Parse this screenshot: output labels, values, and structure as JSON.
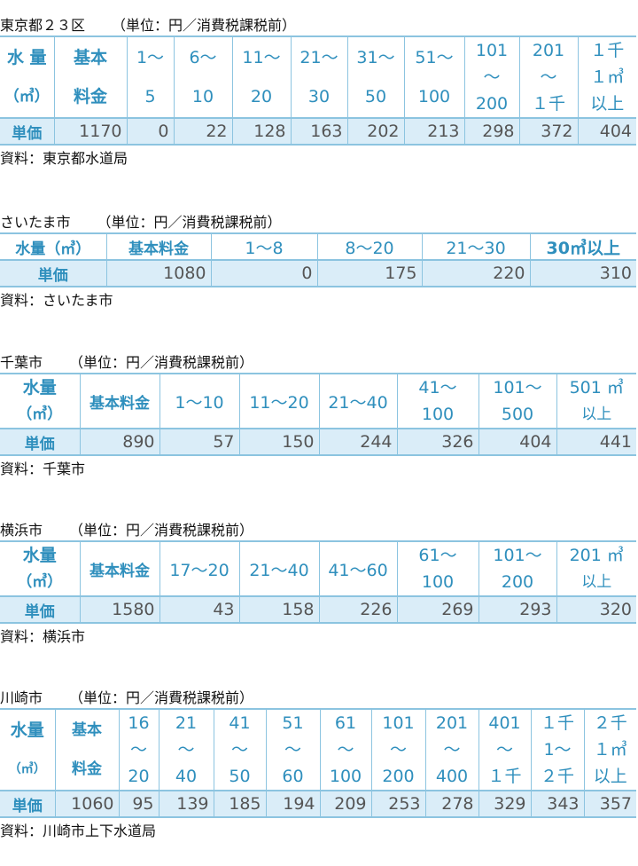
{
  "tokyo": {
    "title": "東京都２３区",
    "unit": "（単位：円／消費税課税前）",
    "head": [
      [
        "水 量",
        "（㎥）"
      ],
      [
        "基本",
        "料金"
      ],
      [
        "1～",
        "5"
      ],
      [
        "6～",
        "10"
      ],
      [
        "11～",
        "20"
      ],
      [
        "21～",
        "30"
      ],
      [
        "31～",
        "50"
      ],
      [
        "51～",
        "100"
      ],
      [
        "101",
        "～",
        "200"
      ],
      [
        "201",
        "～",
        "１千"
      ],
      [
        "１千",
        "１㎥",
        "以上"
      ]
    ],
    "price_label": "単価",
    "prices": [
      "1170",
      "0",
      "22",
      "128",
      "163",
      "202",
      "213",
      "298",
      "372",
      "404"
    ],
    "source": "資料：東京都水道局"
  },
  "saitama": {
    "title": "さいたま市",
    "unit": "（単位：円／消費税課税前）",
    "head": [
      "水量（㎥）",
      "基本料金",
      "1～8",
      "8～20",
      "21～30",
      "30㎥以上"
    ],
    "price_label": "単価",
    "prices": [
      "1080",
      "0",
      "175",
      "220",
      "310"
    ],
    "source": "資料：さいたま市"
  },
  "chiba": {
    "title": "千葉市",
    "unit": "（単位：円／消費税課税前）",
    "head": [
      [
        "水量",
        "（㎥）"
      ],
      [
        "基本料金"
      ],
      [
        "1～10"
      ],
      [
        "11～20"
      ],
      [
        "21～40"
      ],
      [
        "41～",
        "100"
      ],
      [
        "101～",
        "500"
      ],
      [
        "501 ㎥",
        "以上"
      ]
    ],
    "price_label": "単価",
    "prices": [
      "890",
      "57",
      "150",
      "244",
      "326",
      "404",
      "441"
    ],
    "source": "資料：千葉市"
  },
  "yokohama": {
    "title": "横浜市",
    "unit": "（単位：円／消費税課税前）",
    "head": [
      [
        "水量",
        "（㎥）"
      ],
      [
        "基本料金"
      ],
      [
        "17～20"
      ],
      [
        "21～40"
      ],
      [
        "41～60"
      ],
      [
        "61～",
        "100"
      ],
      [
        "101～",
        "200"
      ],
      [
        "201 ㎥",
        "以上"
      ]
    ],
    "price_label": "単価",
    "prices": [
      "1580",
      "43",
      "158",
      "226",
      "269",
      "293",
      "320"
    ],
    "source": "資料：横浜市"
  },
  "kawasaki": {
    "title": "川崎市",
    "unit": "（単位：円／消費税課税前）",
    "head": [
      [
        "水量",
        "（㎥）"
      ],
      [
        "基本",
        "料金"
      ],
      [
        "16",
        "～",
        "20"
      ],
      [
        "21",
        "～",
        "40"
      ],
      [
        "41",
        "～",
        "50"
      ],
      [
        "51",
        "～",
        "60"
      ],
      [
        "61",
        "～",
        "100"
      ],
      [
        "101",
        "～",
        "200"
      ],
      [
        "201",
        "～",
        "400"
      ],
      [
        "401",
        "～",
        "１千"
      ],
      [
        "１千",
        "1～",
        "２千"
      ],
      [
        "２千",
        "１㎥",
        "以上"
      ]
    ],
    "price_label": "単価",
    "prices": [
      "1060",
      "95",
      "139",
      "185",
      "194",
      "209",
      "253",
      "278",
      "329",
      "343",
      "357"
    ],
    "source": "資料：川崎市上下水道局"
  }
}
